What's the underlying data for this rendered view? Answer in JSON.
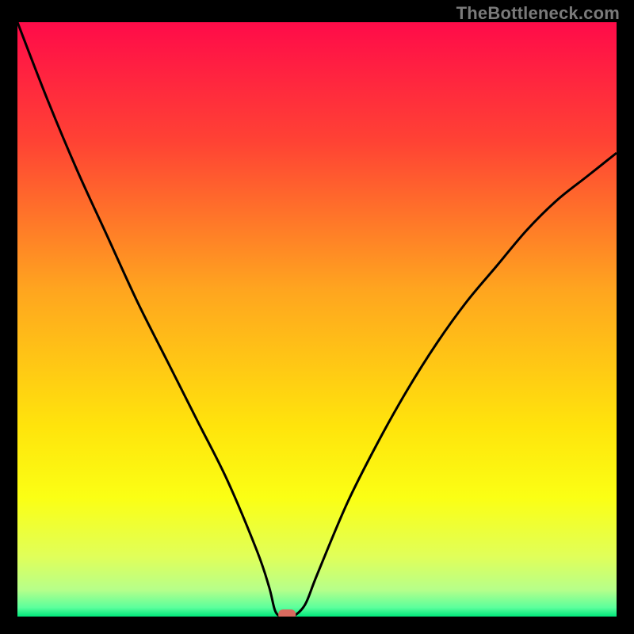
{
  "watermark": {
    "text": "TheBottleneck.com"
  },
  "chart_data": {
    "type": "line",
    "title": "",
    "xlabel": "",
    "ylabel": "",
    "xlim": [
      0,
      100
    ],
    "ylim": [
      0,
      100
    ],
    "x": [
      0,
      5,
      10,
      15,
      20,
      25,
      30,
      35,
      40,
      42,
      43,
      44,
      45,
      46,
      48,
      50,
      55,
      60,
      65,
      70,
      75,
      80,
      85,
      90,
      95,
      100
    ],
    "values": [
      100,
      87,
      75,
      64,
      53,
      43,
      33,
      23,
      11,
      5,
      1,
      0,
      0,
      0,
      2,
      7,
      19,
      29,
      38,
      46,
      53,
      59,
      65,
      70,
      74,
      78
    ],
    "annotations": [
      {
        "label": "marker",
        "x": 45,
        "y": 0
      }
    ],
    "background_gradient": {
      "stops": [
        {
          "pos": 0.0,
          "color": "#ff0b49"
        },
        {
          "pos": 0.2,
          "color": "#ff4234"
        },
        {
          "pos": 0.45,
          "color": "#ffa51f"
        },
        {
          "pos": 0.68,
          "color": "#ffe40c"
        },
        {
          "pos": 0.8,
          "color": "#fbff14"
        },
        {
          "pos": 0.9,
          "color": "#e0ff5a"
        },
        {
          "pos": 0.955,
          "color": "#b6ff8a"
        },
        {
          "pos": 0.985,
          "color": "#5bff9c"
        },
        {
          "pos": 1.0,
          "color": "#00e67a"
        }
      ]
    },
    "marker": {
      "color": "#d96a5f"
    }
  }
}
